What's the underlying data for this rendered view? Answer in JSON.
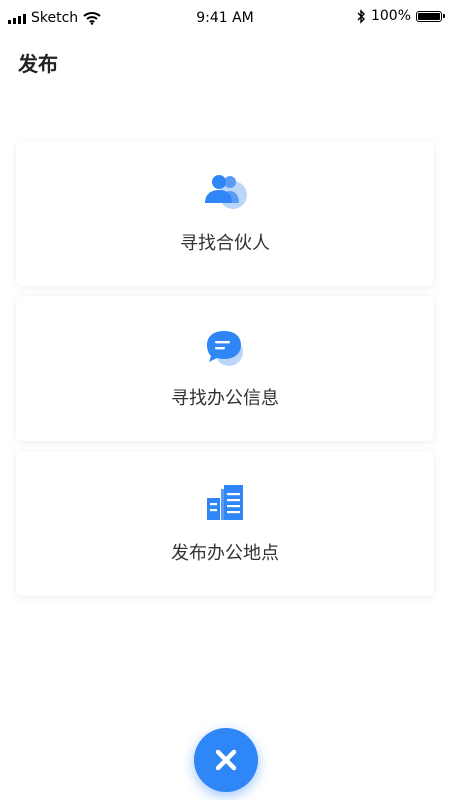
{
  "status_bar": {
    "carrier": "Sketch",
    "time": "9:41 AM",
    "battery": "100%",
    "battery_level": 1.0
  },
  "header": {
    "title": "发布"
  },
  "options": [
    {
      "label": "寻找合伙人",
      "icon": "partners-icon"
    },
    {
      "label": "寻找办公信息",
      "icon": "chat-icon"
    },
    {
      "label": "发布办公地点",
      "icon": "buildings-icon"
    }
  ],
  "close_button": {
    "icon": "close-icon"
  },
  "colors": {
    "accent": "#2f86f6",
    "icon_light": "#8fb9f5"
  }
}
